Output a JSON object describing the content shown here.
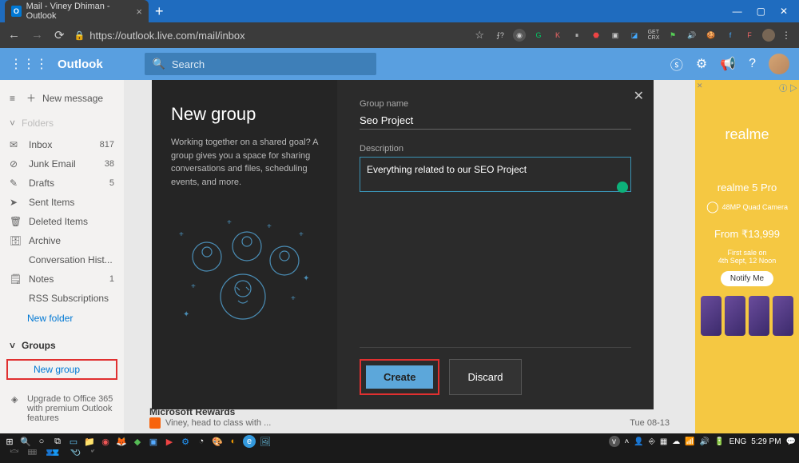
{
  "browser": {
    "tab_title": "Mail - Viney Dhiman - Outlook",
    "url": "https://outlook.live.com/mail/inbox"
  },
  "outlook": {
    "brand": "Outlook",
    "search_placeholder": "Search"
  },
  "sidebar": {
    "new_message": "New message",
    "folders_label": "Folders",
    "items": [
      {
        "icon": "📥",
        "label": "Inbox",
        "count": "817"
      },
      {
        "icon": "🚫",
        "label": "Junk Email",
        "count": "38"
      },
      {
        "icon": "✎",
        "label": "Drafts",
        "count": "5"
      },
      {
        "icon": "➤",
        "label": "Sent Items",
        "count": ""
      },
      {
        "icon": "🗑",
        "label": "Deleted Items",
        "count": ""
      },
      {
        "icon": "🗄",
        "label": "Archive",
        "count": ""
      },
      {
        "icon": "",
        "label": "Conversation Hist...",
        "count": ""
      },
      {
        "icon": "🗒",
        "label": "Notes",
        "count": "1"
      },
      {
        "icon": "",
        "label": "RSS Subscriptions",
        "count": ""
      }
    ],
    "new_folder": "New folder",
    "groups_label": "Groups",
    "new_group": "New group",
    "upgrade": "Upgrade to Office 365 with premium Outlook features"
  },
  "dialog": {
    "title": "New group",
    "description": "Working together on a shared goal? A group gives you a space for sharing conversations and files, scheduling events, and more.",
    "group_name_label": "Group name",
    "group_name_value": "Seo Project",
    "description_label": "Description",
    "description_value": "Everything related to our SEO Project",
    "create": "Create",
    "discard": "Discard"
  },
  "messages": {
    "sender": "Microsoft Rewards",
    "subject": "Viney, head to class with ...",
    "date": "Tue 08-13"
  },
  "ad": {
    "logo": "realme",
    "model": "realme 5 Pro",
    "spec": "48MP Quad Camera",
    "price": "From ₹13,999",
    "sale1": "First sale on",
    "sale2": "4th Sept, 12 Noon",
    "button": "Notify Me"
  },
  "taskbar": {
    "lang": "ENG",
    "time": "5:29 PM"
  }
}
